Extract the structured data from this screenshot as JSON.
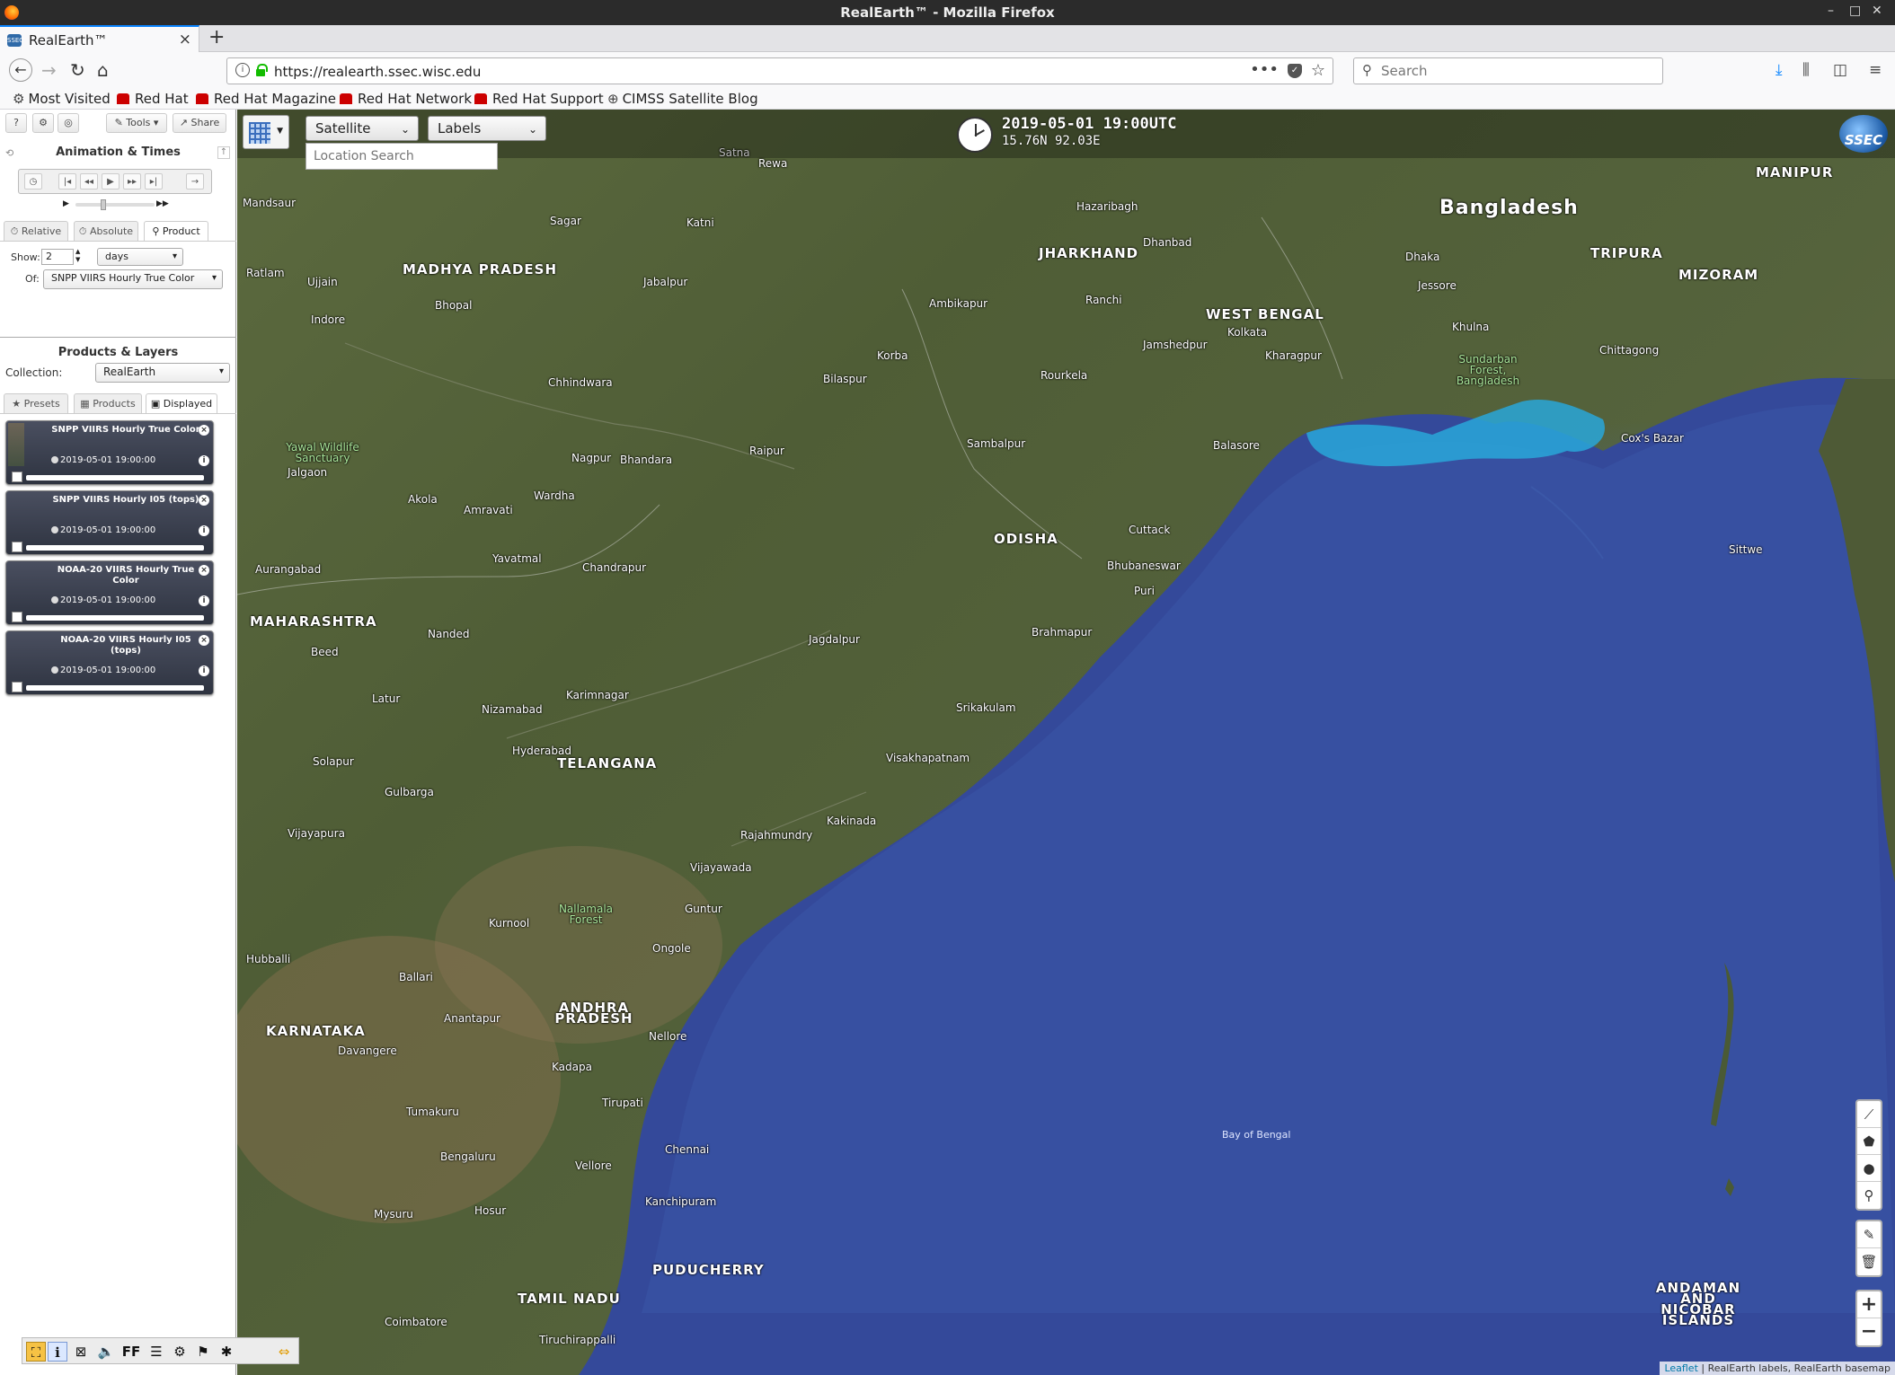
{
  "window": {
    "title": "RealEarth™ - Mozilla Firefox"
  },
  "tab": {
    "title": "RealEarth™",
    "favicon": "ssec-icon"
  },
  "nav": {
    "url": "https://realearth.ssec.wisc.edu",
    "search_placeholder": "Search"
  },
  "bookmarks": [
    {
      "label": "Most Visited",
      "icon": "gear-icon"
    },
    {
      "label": "Red Hat",
      "icon": "redhat-icon"
    },
    {
      "label": "Red Hat Magazine",
      "icon": "redhat-icon"
    },
    {
      "label": "Red Hat Network",
      "icon": "redhat-icon"
    },
    {
      "label": "Red Hat Support",
      "icon": "redhat-icon"
    },
    {
      "label": "CIMSS Satellite Blog",
      "icon": "globe-icon"
    }
  ],
  "panel": {
    "toolbar": {
      "help": "?",
      "tools": "Tools",
      "share": "Share"
    },
    "animation_title": "Animation & Times",
    "time_tabs": [
      "Relative",
      "Absolute",
      "Product"
    ],
    "show_label": "Show:",
    "show_value": "2",
    "show_unit": "days",
    "of_label": "Of:",
    "of_value": "SNPP VIIRS Hourly True Color",
    "products_title": "Products & Layers",
    "collection_label": "Collection:",
    "collection_value": "RealEarth",
    "layer_tabs": [
      "Presets",
      "Products",
      "Displayed"
    ],
    "layers": [
      {
        "title": "SNPP VIIRS Hourly True Color",
        "time": "2019-05-01 19:00:00"
      },
      {
        "title": "SNPP VIIRS Hourly I05 (tops)",
        "time": "2019-05-01 19:00:00"
      },
      {
        "title": "NOAA-20 VIIRS Hourly True Color",
        "time": "2019-05-01 19:00:00"
      },
      {
        "title": "NOAA-20 VIIRS Hourly I05 (tops)",
        "time": "2019-05-01 19:00:00"
      }
    ]
  },
  "map": {
    "basemap_select": "Satellite",
    "labels_select": "Labels",
    "location_placeholder": "Location Search",
    "datetime": "2019-05-01 19:00UTC",
    "coords": "15.76N 92.03E",
    "logo": "SSEC",
    "attribution_link": "Leaflet",
    "attribution_text": "| RealEarth labels, RealEarth basemap",
    "zoom_in": "+",
    "zoom_out": "−",
    "places": {
      "madhya_pradesh": "MADHYA PRADESH",
      "jharkhand": "JHARKHAND",
      "west_bengal": "WEST BENGAL",
      "bangladesh": "Bangladesh",
      "tripura": "TRIPURA",
      "mizoram": "MIZORAM",
      "manipur": "MANIPUR",
      "maharashtra": "MAHARASHTRA",
      "odisha": "ODISHA",
      "telangana": "TELANGANA",
      "andhra_pradesh": "ANDHRA PRADESH",
      "karnataka": "KARNATAKA",
      "tamil_nadu": "TAMIL NADU",
      "puducherry": "PUDUCHERRY",
      "andaman": "ANDAMAN AND NICOBAR ISLANDS",
      "bay_of_bengal": "Bay of Bengal",
      "bhopal": "Bhopal",
      "indore": "Indore",
      "nagpur": "Nagpur",
      "kolkata": "Kolkata",
      "dhaka": "Dhaka",
      "chittagong": "Chittagong",
      "khulna": "Khulna",
      "ranchi": "Ranchi",
      "hyderabad": "Hyderabad",
      "visakhapatnam": "Visakhapatnam",
      "chennai": "Chennai",
      "bengaluru": "Bengaluru",
      "coimbatore": "Coimbatore",
      "cuttack": "Cuttack",
      "bhubaneswar": "Bhubaneswar",
      "vijayawada": "Vijayawada",
      "kakinada": "Kakinada",
      "rajahmundry": "Rajahmundry",
      "guntur": "Guntur",
      "nellore": "Nellore",
      "raipur": "Raipur",
      "bilaspur": "Bilaspur",
      "jabalpur": "Jabalpur",
      "sagar": "Sagar",
      "ujjain": "Ujjain",
      "aurangabad": "Aurangabad",
      "nanded": "Nanded",
      "solapur": "Solapur",
      "gulbarga": "Gulbarga",
      "bijapur": "Vijayapura",
      "hubballi": "Hubballi",
      "ballari": "Ballari",
      "kurnool": "Kurnool",
      "ongole": "Ongole",
      "tirupati": "Tirupati",
      "vellore": "Vellore",
      "mysuru": "Mysuru",
      "hosur": "Hosur",
      "tumakuru": "Tumakuru",
      "davangere": "Davangere",
      "anantapur": "Anantapur",
      "kadapa": "Kadapa",
      "srikakulam": "Srikakulam",
      "jagdalpur": "Jagdalpur",
      "sambalpur": "Sambalpur",
      "rourkela": "Rourkela",
      "jamshedpur": "Jamshedpur",
      "dhanbad": "Dhanbad",
      "hazaribagh": "Hazaribagh",
      "bhandara": "Bhandara",
      "wardha": "Wardha",
      "amravati": "Amravati",
      "akola": "Akola",
      "jalgaon": "Jalgaon",
      "chhindwara": "Chhindwara",
      "balasore": "Balasore",
      "kharagpur": "Kharagpur",
      "brahmapur": "Brahmapur",
      "puri": "Puri",
      "coxs_bazar": "Cox's Bazar",
      "tiruchirappalli": "Tiruchirappalli",
      "kanchipuram": "Kanchipuram",
      "nizamabad": "Nizamabad",
      "karimnagar": "Karimnagar",
      "chandrapur": "Chandrapur",
      "yavatmal": "Yavatmal",
      "beed": "Beed",
      "latur": "Latur",
      "ratlam": "Ratlam",
      "mandsaur": "Mandsaur",
      "satna": "Satna",
      "rewa": "Rewa",
      "katni": "Katni",
      "ambikapur": "Ambikapur",
      "korba": "Korba",
      "jessore": "Jessore",
      "sittwe": "Sittwe",
      "nallamala": "Nallamala Forest",
      "yawal": "Yawal Wildlife Sanctuary",
      "sundarban": "Sundarban Forest, Bangladesh"
    }
  },
  "tray_icons": [
    "app-icon",
    "info-icon",
    "close-box-icon",
    "speaker-icon",
    "ff-icon",
    "menu-icon",
    "puzzle-icon",
    "flag-icon",
    "bug-icon",
    "arrows-icon"
  ]
}
